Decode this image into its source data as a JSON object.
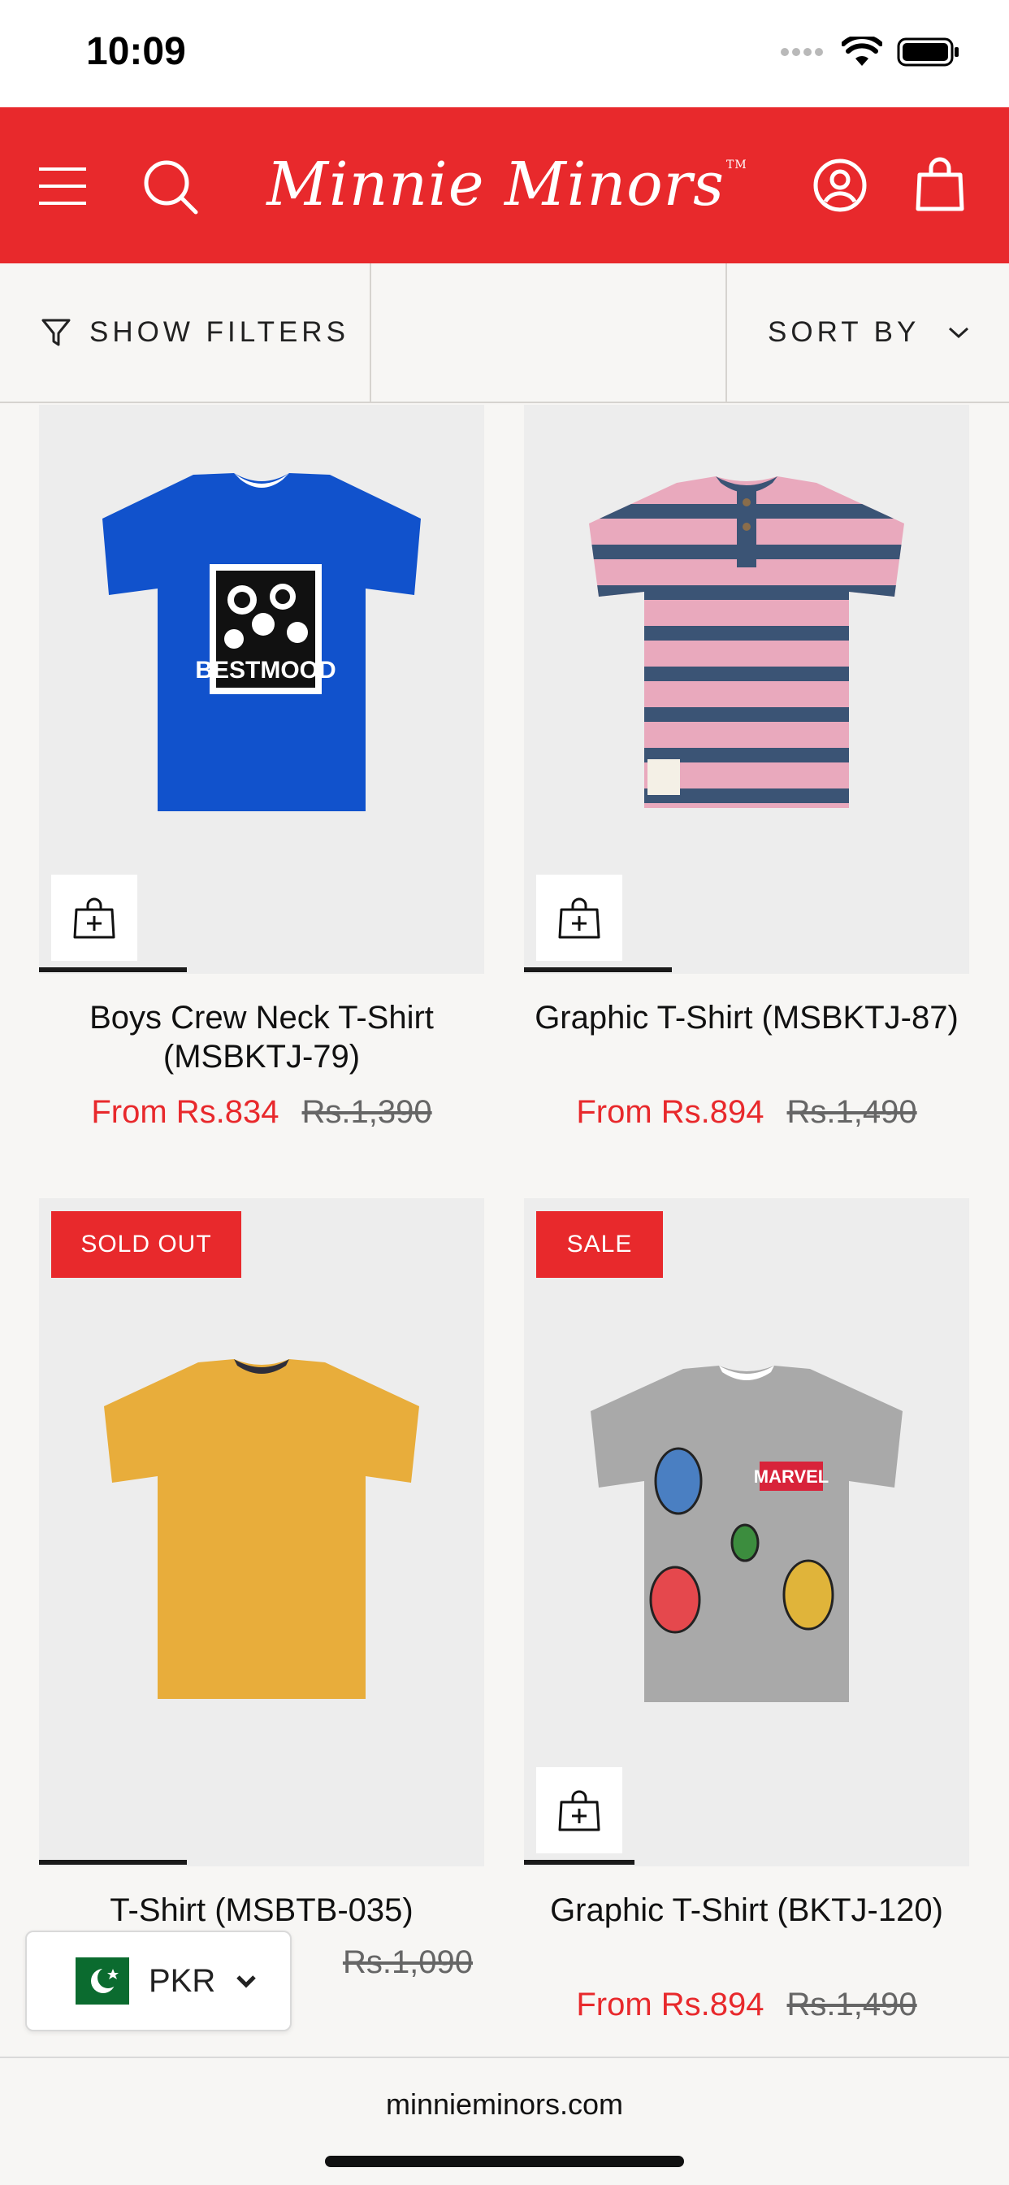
{
  "status_bar": {
    "time": "10:09"
  },
  "header": {
    "logo_text": "Minnie Minors",
    "trademark": "TM",
    "brand_color": "#e8292c",
    "icons": [
      "menu-icon",
      "search-icon",
      "account-icon",
      "cart-icon"
    ]
  },
  "filters": {
    "show_filters_label": "SHOW FILTERS",
    "sort_by_label": "SORT BY"
  },
  "products": [
    {
      "title": "Boys Crew Neck T-Shirt (MSBKTJ-79)",
      "price": "From Rs.834",
      "compare_price": "Rs.1,390",
      "badge": "",
      "graphic_text": "BESTMOOD",
      "shirt_color": "#1152cc"
    },
    {
      "title": "Graphic T-Shirt (MSBKTJ-87)",
      "price": "From Rs.894",
      "compare_price": "Rs.1,490",
      "badge": "",
      "shirt_color": "#e9a9bd"
    },
    {
      "title": "T-Shirt (MSBTB-035)",
      "price": "",
      "compare_price": "Rs.1,090",
      "badge": "SOLD OUT",
      "shirt_color": "#e8ad3b"
    },
    {
      "title": "Graphic T-Shirt (BKTJ-120)",
      "price": "From Rs.894",
      "compare_price": "Rs.1,490",
      "badge": "SALE",
      "graphic_text": "MARVEL",
      "shirt_color": "#a9a9a9"
    }
  ],
  "currency": {
    "label": "PKR",
    "flag": "pakistan-flag-icon"
  },
  "browser": {
    "url": "minnieminors.com"
  }
}
